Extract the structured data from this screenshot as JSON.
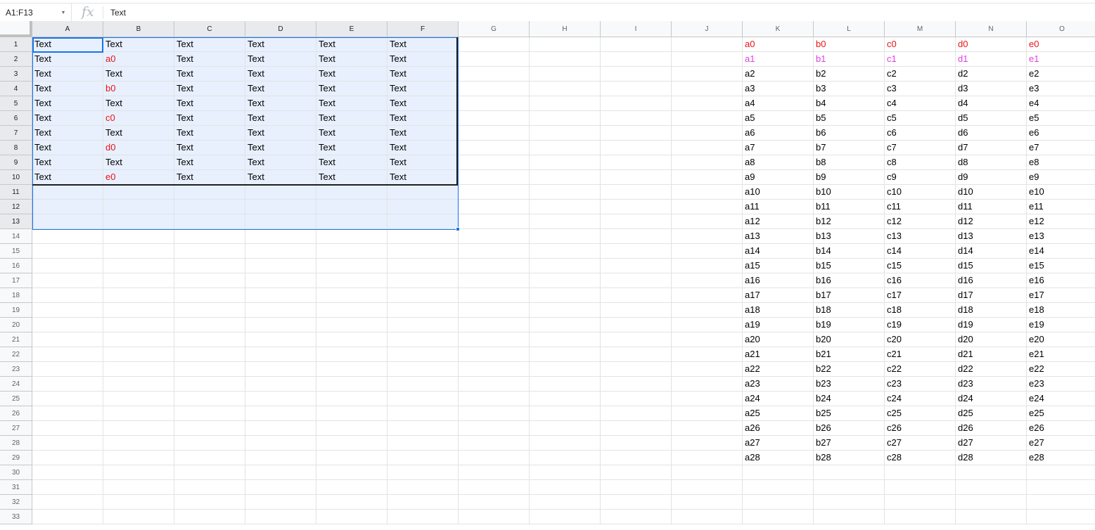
{
  "name_box": "A1:F13",
  "formula_bar": {
    "fx_icon": "fx-icon",
    "value": "Text"
  },
  "columns": [
    "A",
    "B",
    "C",
    "D",
    "E",
    "F",
    "G",
    "H",
    "I",
    "J",
    "K",
    "L",
    "M",
    "N",
    "O"
  ],
  "rows": [
    "1",
    "2",
    "3",
    "4",
    "5",
    "6",
    "7",
    "8",
    "9",
    "10",
    "11",
    "12",
    "13",
    "14",
    "15",
    "16",
    "17",
    "18",
    "19",
    "20",
    "21",
    "22",
    "23",
    "24",
    "25",
    "26",
    "27",
    "28",
    "29",
    "30",
    "31",
    "32",
    "33"
  ],
  "selection": "A1:F13",
  "colors": {
    "red": "#e81416",
    "magenta": "#e03ee0",
    "selection_fill": "#e8f0fe",
    "selection_border": "#1a73e8"
  },
  "cells": {
    "A1": "Text",
    "B1": "Text",
    "C1": "Text",
    "D1": "Text",
    "E1": "Text",
    "F1": "Text",
    "A2": "Text",
    "B2": "a0",
    "C2": "Text",
    "D2": "Text",
    "E2": "Text",
    "F2": "Text",
    "A3": "Text",
    "B3": "Text",
    "C3": "Text",
    "D3": "Text",
    "E3": "Text",
    "F3": "Text",
    "A4": "Text",
    "B4": "b0",
    "C4": "Text",
    "D4": "Text",
    "E4": "Text",
    "F4": "Text",
    "A5": "Text",
    "B5": "Text",
    "C5": "Text",
    "D5": "Text",
    "E5": "Text",
    "F5": "Text",
    "A6": "Text",
    "B6": "c0",
    "C6": "Text",
    "D6": "Text",
    "E6": "Text",
    "F6": "Text",
    "A7": "Text",
    "B7": "Text",
    "C7": "Text",
    "D7": "Text",
    "E7": "Text",
    "F7": "Text",
    "A8": "Text",
    "B8": "d0",
    "C8": "Text",
    "D8": "Text",
    "E8": "Text",
    "F8": "Text",
    "A9": "Text",
    "B9": "Text",
    "C9": "Text",
    "D9": "Text",
    "E9": "Text",
    "F9": "Text",
    "A10": "Text",
    "B10": "e0",
    "C10": "Text",
    "D10": "Text",
    "E10": "Text",
    "F10": "Text",
    "K1": "a0",
    "L1": "b0",
    "M1": "c0",
    "N1": "d0",
    "O1": "e0",
    "K2": "a1",
    "L2": "b1",
    "M2": "c1",
    "N2": "d1",
    "O2": "e1",
    "K3": "a2",
    "L3": "b2",
    "M3": "c2",
    "N3": "d2",
    "O3": "e2",
    "K4": "a3",
    "L4": "b3",
    "M4": "c3",
    "N4": "d3",
    "O4": "e3",
    "K5": "a4",
    "L5": "b4",
    "M5": "c4",
    "N5": "d4",
    "O5": "e4",
    "K6": "a5",
    "L6": "b5",
    "M6": "c5",
    "N6": "d5",
    "O6": "e5",
    "K7": "a6",
    "L7": "b6",
    "M7": "c6",
    "N7": "d6",
    "O7": "e6",
    "K8": "a7",
    "L8": "b7",
    "M8": "c7",
    "N8": "d7",
    "O8": "e7",
    "K9": "a8",
    "L9": "b8",
    "M9": "c8",
    "N9": "d8",
    "O9": "e8",
    "K10": "a9",
    "L10": "b9",
    "M10": "c9",
    "N10": "d9",
    "O10": "e9",
    "K11": "a10",
    "L11": "b10",
    "M11": "c10",
    "N11": "d10",
    "O11": "e10",
    "K12": "a11",
    "L12": "b11",
    "M12": "c11",
    "N12": "d11",
    "O12": "e11",
    "K13": "a12",
    "L13": "b12",
    "M13": "c12",
    "N13": "d12",
    "O13": "e12",
    "K14": "a13",
    "L14": "b13",
    "M14": "c13",
    "N14": "d13",
    "O14": "e13",
    "K15": "a14",
    "L15": "b14",
    "M15": "c14",
    "N15": "d14",
    "O15": "e14",
    "K16": "a15",
    "L16": "b15",
    "M16": "c15",
    "N16": "d15",
    "O16": "e15",
    "K17": "a16",
    "L17": "b16",
    "M17": "c16",
    "N17": "d16",
    "O17": "e16",
    "K18": "a17",
    "L18": "b17",
    "M18": "c17",
    "N18": "d17",
    "O18": "e17",
    "K19": "a18",
    "L19": "b18",
    "M19": "c18",
    "N19": "d18",
    "O19": "e18",
    "K20": "a19",
    "L20": "b19",
    "M20": "c19",
    "N20": "d19",
    "O20": "e19",
    "K21": "a20",
    "L21": "b20",
    "M21": "c20",
    "N21": "d20",
    "O21": "e20",
    "K22": "a21",
    "L22": "b21",
    "M22": "c21",
    "N22": "d21",
    "O22": "e21",
    "K23": "a22",
    "L23": "b22",
    "M23": "c22",
    "N23": "d22",
    "O23": "e22",
    "K24": "a23",
    "L24": "b23",
    "M24": "c23",
    "N24": "d23",
    "O24": "e23",
    "K25": "a24",
    "L25": "b24",
    "M25": "c24",
    "N25": "d24",
    "O25": "e24",
    "K26": "a25",
    "L26": "b25",
    "M26": "c25",
    "N26": "d25",
    "O26": "e25",
    "K27": "a26",
    "L27": "b26",
    "M27": "c26",
    "N27": "d26",
    "O27": "e26",
    "K28": "a27",
    "L28": "b27",
    "M28": "c27",
    "N28": "d27",
    "O28": "e27",
    "K29": "a28",
    "L29": "b28",
    "M29": "c28",
    "N29": "d28",
    "O29": "e28"
  },
  "red_cells": [
    "B2",
    "B4",
    "B6",
    "B8",
    "B10",
    "K1",
    "L1",
    "M1",
    "N1",
    "O1"
  ],
  "magenta_cells": [
    "K2",
    "L2",
    "M2",
    "N2",
    "O2"
  ]
}
